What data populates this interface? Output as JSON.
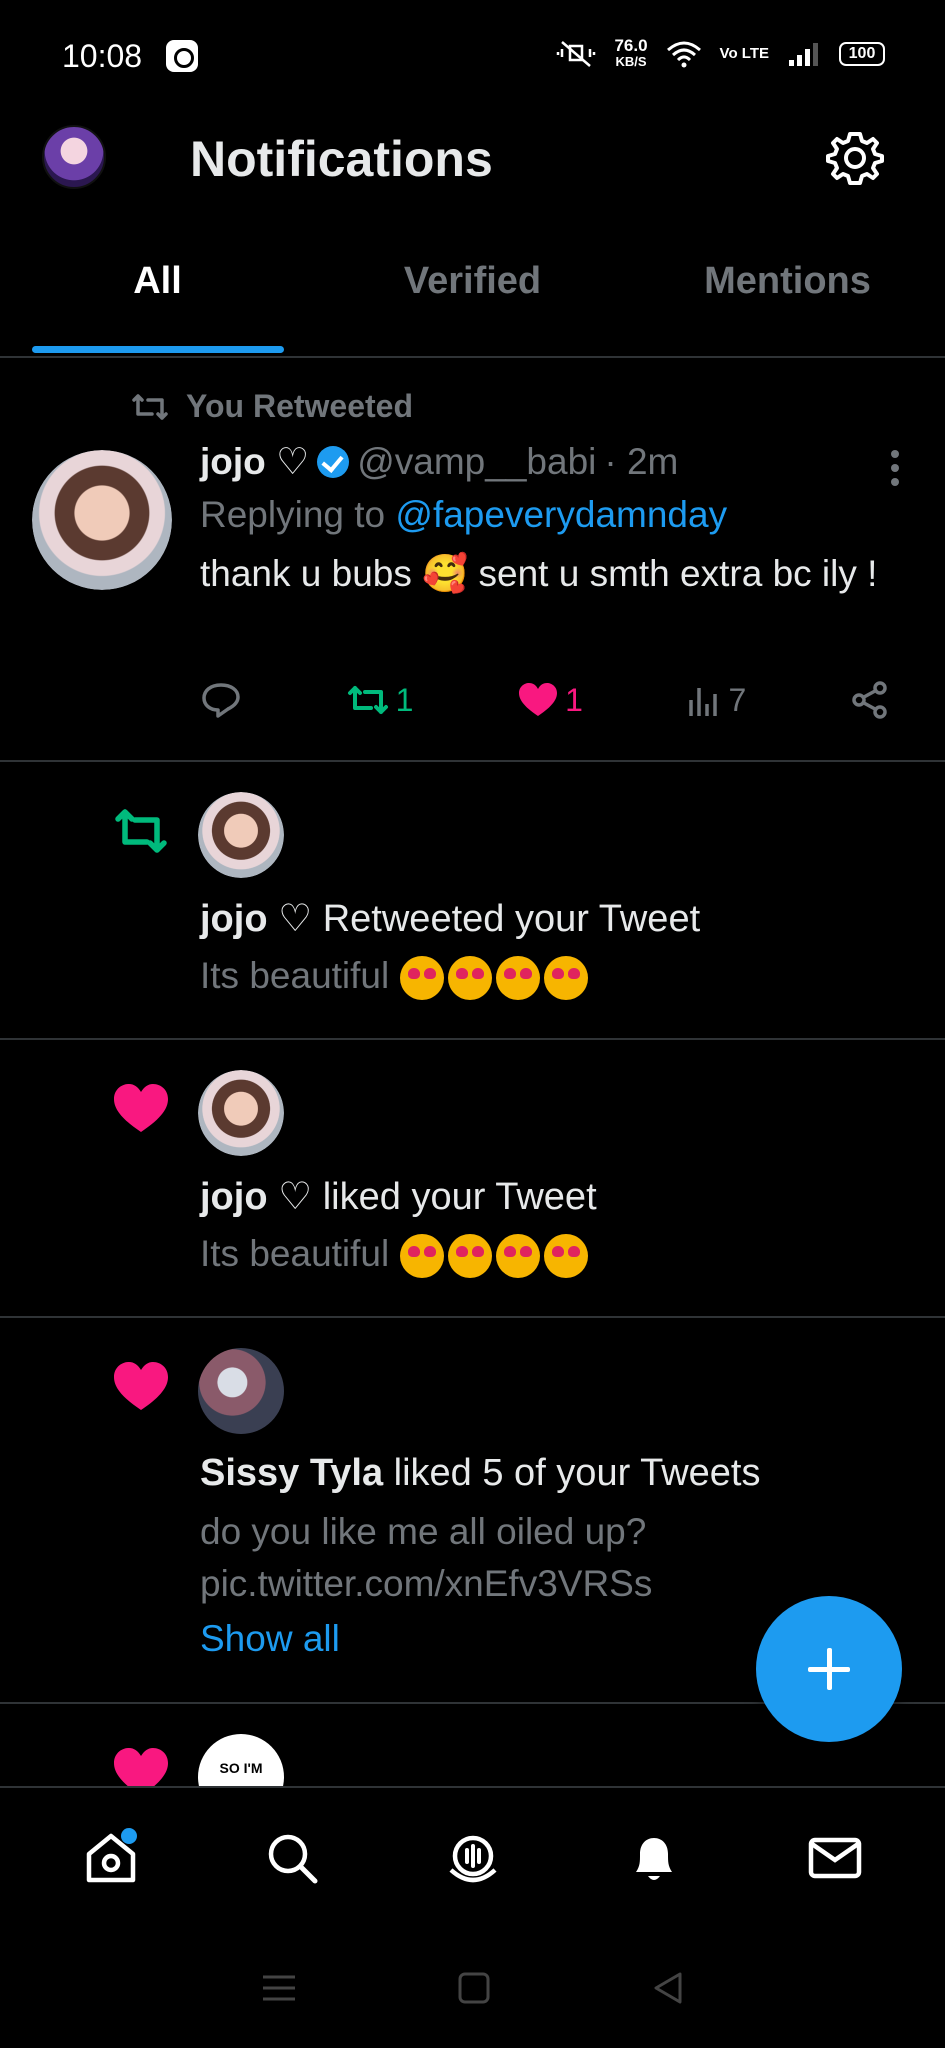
{
  "status_bar": {
    "time": "10:08",
    "net_speed": "76.0",
    "net_unit": "KB/S",
    "volte": "Vo LTE",
    "battery": "100"
  },
  "header": {
    "title": "Notifications",
    "tabs": [
      {
        "label": "All",
        "active": true
      },
      {
        "label": "Verified",
        "active": false
      },
      {
        "label": "Mentions",
        "active": false
      }
    ]
  },
  "feed": {
    "tweet": {
      "context": "You Retweeted",
      "name": "jojo ♡",
      "handle": "@vamp__babi",
      "time": "· 2m",
      "replying_prefix": "Replying to",
      "replying_to": "@fapeverydamnday",
      "text": "thank u bubs 🥰 sent u smth extra bc ily !",
      "retweets": "1",
      "likes": "1",
      "views": "7"
    },
    "notifications": [
      {
        "type": "retweet",
        "actor": "jojo ♡",
        "action": "Retweeted your Tweet",
        "body": "Its beautiful"
      },
      {
        "type": "like",
        "actor": "jojo ♡",
        "action": "liked your Tweet",
        "body": "Its beautiful"
      },
      {
        "type": "like",
        "actor": "Sissy Tyla",
        "action": "liked 5 of your Tweets",
        "body": "do you like me all oiled up? pic.twitter.com/xnEfv3VRSs",
        "show_all": "Show all"
      },
      {
        "type": "like",
        "avatar_text": "SO I'M"
      }
    ]
  },
  "colors": {
    "accent": "#1d9bf0",
    "retweet": "#00ba7c",
    "like": "#f91880",
    "muted": "#71767b"
  },
  "icons": [
    "gear-icon",
    "retweet-icon",
    "heart-icon",
    "reply-icon",
    "views-icon",
    "share-icon",
    "home-icon",
    "search-icon",
    "spaces-icon",
    "bell-icon",
    "mail-icon",
    "plus-icon"
  ]
}
